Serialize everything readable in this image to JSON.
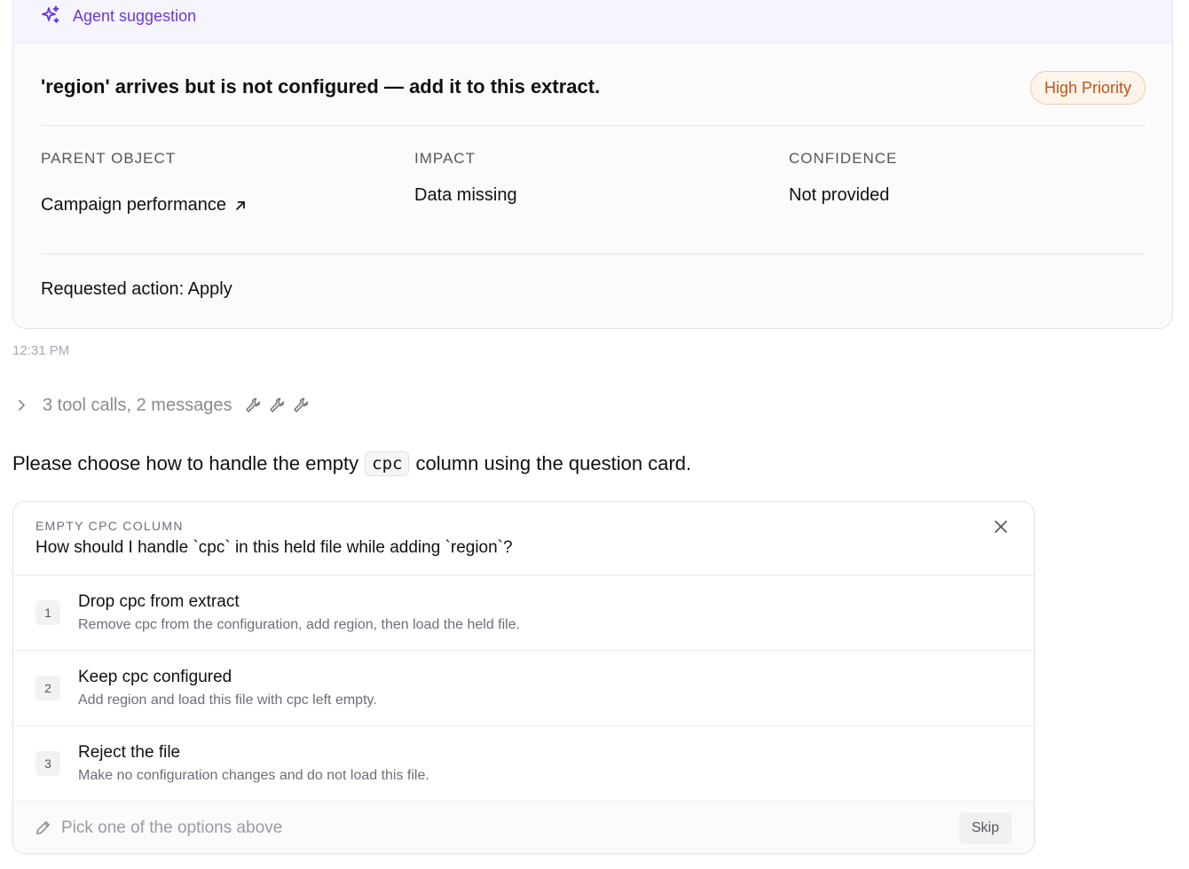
{
  "suggestion": {
    "header_label": "Agent suggestion",
    "title": "'region' arrives but is not configured — add it to this extract.",
    "priority": "High Priority",
    "parent_object": {
      "label": "PARENT OBJECT",
      "value": "Campaign performance"
    },
    "impact": {
      "label": "IMPACT",
      "value": "Data missing"
    },
    "confidence": {
      "label": "CONFIDENCE",
      "value": "Not provided"
    },
    "requested_action": "Requested action: Apply",
    "accent_color": "#6b37d6",
    "priority_color": "#c0541c"
  },
  "timestamp": "12:31 PM",
  "tool_calls": {
    "summary": "3 tool calls, 2 messages",
    "icons": [
      "wrench-icon",
      "wrench-icon",
      "wrench-icon"
    ]
  },
  "message": {
    "before": "Please choose how to handle the empty",
    "code": "cpc",
    "after": "column using the question card."
  },
  "question": {
    "eyebrow": "EMPTY CPC COLUMN",
    "title": "How should I handle `cpc` in this held file while adding `region`?",
    "options": [
      {
        "number": "1",
        "title": "Drop cpc from extract",
        "description": "Remove cpc from the configuration, add region, then load the held file."
      },
      {
        "number": "2",
        "title": "Keep cpc configured",
        "description": "Add region and load this file with cpc left empty."
      },
      {
        "number": "3",
        "title": "Reject the file",
        "description": "Make no configuration changes and do not load this file."
      }
    ],
    "input_placeholder": "Pick one of the options above",
    "skip_label": "Skip"
  }
}
